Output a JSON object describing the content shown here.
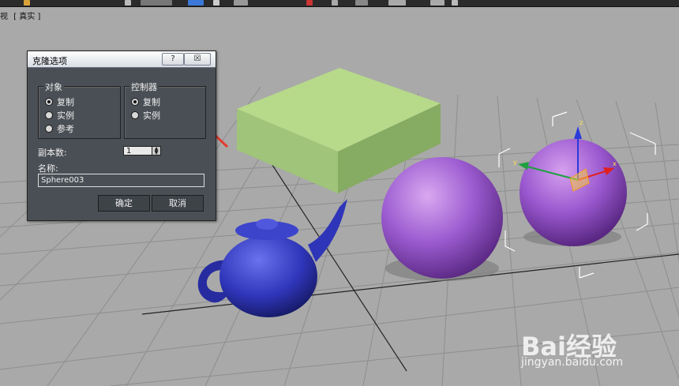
{
  "viewport": {
    "labels": [
      "视",
      "[ 真实 ]"
    ]
  },
  "dialog": {
    "title": "克隆选项",
    "help_label": "?",
    "close_label": "☒",
    "object_group": {
      "legend": "对象",
      "options": [
        "复制",
        "实例",
        "参考"
      ],
      "selected_index": 0
    },
    "controller_group": {
      "legend": "控制器",
      "options": [
        "复制",
        "实例"
      ],
      "selected_index": 0
    },
    "copies_label": "副本数:",
    "copies_value": "1",
    "name_label": "名称:",
    "name_value": "Sphere003",
    "ok_label": "确定",
    "cancel_label": "取消"
  },
  "gizmo": {
    "z_label": "z",
    "x_label": "x",
    "y_label": "y"
  },
  "watermark": {
    "brand": "Bai经验",
    "url": "jingyan.baidu.com"
  },
  "colors": {
    "viewport_bg": "#a9a9a9",
    "box": "#b6d98a",
    "teapot": "#2f35b8",
    "sphere": "#9b5bd0",
    "arrow": "#e53a2e"
  }
}
